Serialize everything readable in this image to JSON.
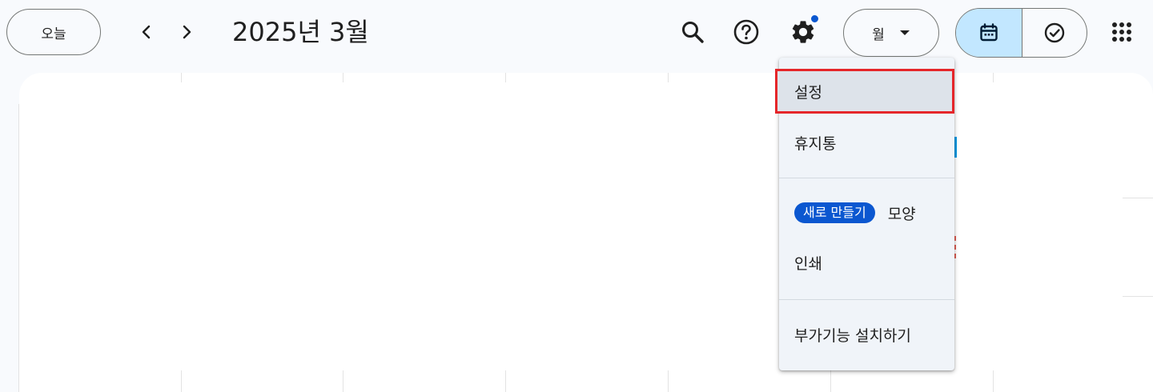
{
  "header": {
    "today_label": "오늘",
    "prev_icon": "chevron-left-icon",
    "next_icon": "chevron-right-icon",
    "title": "2025년 3월",
    "view_select_value": "월",
    "search_icon": "search-icon",
    "help_icon": "help-icon",
    "settings_icon": "gear-icon",
    "apps_icon": "apps-grid-icon"
  },
  "mode_toggle": {
    "calendar_icon": "calendar-icon",
    "tasks_icon": "task-check-icon",
    "active": "calendar"
  },
  "settings_menu": {
    "items": [
      {
        "label": "설정",
        "highlighted": true
      },
      {
        "label": "휴지통"
      },
      {
        "badge": "새로 만들기",
        "label": "모양"
      },
      {
        "label": "인쇄"
      },
      {
        "label": "부가기능 설치하기"
      }
    ]
  },
  "colors": {
    "accent": "#0b57d0",
    "active_toggle": "#c2e7ff",
    "highlight_outline": "#e5262a",
    "menu_bg": "#f0f4f9",
    "page_bg": "#f8fafd"
  }
}
